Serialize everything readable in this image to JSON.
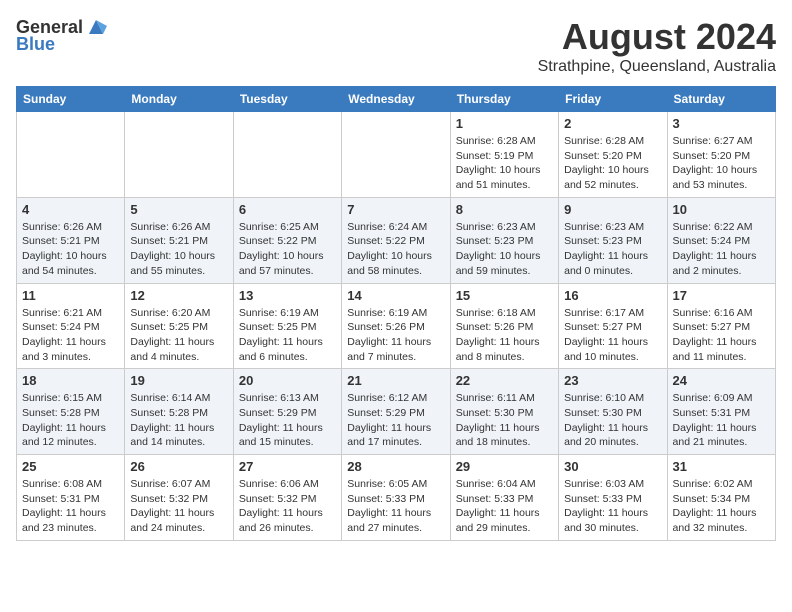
{
  "header": {
    "logo_general": "General",
    "logo_blue": "Blue",
    "month_year": "August 2024",
    "location": "Strathpine, Queensland, Australia"
  },
  "weekdays": [
    "Sunday",
    "Monday",
    "Tuesday",
    "Wednesday",
    "Thursday",
    "Friday",
    "Saturday"
  ],
  "weeks": [
    [
      {
        "day": "",
        "info": ""
      },
      {
        "day": "",
        "info": ""
      },
      {
        "day": "",
        "info": ""
      },
      {
        "day": "",
        "info": ""
      },
      {
        "day": "1",
        "info": "Sunrise: 6:28 AM\nSunset: 5:19 PM\nDaylight: 10 hours\nand 51 minutes."
      },
      {
        "day": "2",
        "info": "Sunrise: 6:28 AM\nSunset: 5:20 PM\nDaylight: 10 hours\nand 52 minutes."
      },
      {
        "day": "3",
        "info": "Sunrise: 6:27 AM\nSunset: 5:20 PM\nDaylight: 10 hours\nand 53 minutes."
      }
    ],
    [
      {
        "day": "4",
        "info": "Sunrise: 6:26 AM\nSunset: 5:21 PM\nDaylight: 10 hours\nand 54 minutes."
      },
      {
        "day": "5",
        "info": "Sunrise: 6:26 AM\nSunset: 5:21 PM\nDaylight: 10 hours\nand 55 minutes."
      },
      {
        "day": "6",
        "info": "Sunrise: 6:25 AM\nSunset: 5:22 PM\nDaylight: 10 hours\nand 57 minutes."
      },
      {
        "day": "7",
        "info": "Sunrise: 6:24 AM\nSunset: 5:22 PM\nDaylight: 10 hours\nand 58 minutes."
      },
      {
        "day": "8",
        "info": "Sunrise: 6:23 AM\nSunset: 5:23 PM\nDaylight: 10 hours\nand 59 minutes."
      },
      {
        "day": "9",
        "info": "Sunrise: 6:23 AM\nSunset: 5:23 PM\nDaylight: 11 hours\nand 0 minutes."
      },
      {
        "day": "10",
        "info": "Sunrise: 6:22 AM\nSunset: 5:24 PM\nDaylight: 11 hours\nand 2 minutes."
      }
    ],
    [
      {
        "day": "11",
        "info": "Sunrise: 6:21 AM\nSunset: 5:24 PM\nDaylight: 11 hours\nand 3 minutes."
      },
      {
        "day": "12",
        "info": "Sunrise: 6:20 AM\nSunset: 5:25 PM\nDaylight: 11 hours\nand 4 minutes."
      },
      {
        "day": "13",
        "info": "Sunrise: 6:19 AM\nSunset: 5:25 PM\nDaylight: 11 hours\nand 6 minutes."
      },
      {
        "day": "14",
        "info": "Sunrise: 6:19 AM\nSunset: 5:26 PM\nDaylight: 11 hours\nand 7 minutes."
      },
      {
        "day": "15",
        "info": "Sunrise: 6:18 AM\nSunset: 5:26 PM\nDaylight: 11 hours\nand 8 minutes."
      },
      {
        "day": "16",
        "info": "Sunrise: 6:17 AM\nSunset: 5:27 PM\nDaylight: 11 hours\nand 10 minutes."
      },
      {
        "day": "17",
        "info": "Sunrise: 6:16 AM\nSunset: 5:27 PM\nDaylight: 11 hours\nand 11 minutes."
      }
    ],
    [
      {
        "day": "18",
        "info": "Sunrise: 6:15 AM\nSunset: 5:28 PM\nDaylight: 11 hours\nand 12 minutes."
      },
      {
        "day": "19",
        "info": "Sunrise: 6:14 AM\nSunset: 5:28 PM\nDaylight: 11 hours\nand 14 minutes."
      },
      {
        "day": "20",
        "info": "Sunrise: 6:13 AM\nSunset: 5:29 PM\nDaylight: 11 hours\nand 15 minutes."
      },
      {
        "day": "21",
        "info": "Sunrise: 6:12 AM\nSunset: 5:29 PM\nDaylight: 11 hours\nand 17 minutes."
      },
      {
        "day": "22",
        "info": "Sunrise: 6:11 AM\nSunset: 5:30 PM\nDaylight: 11 hours\nand 18 minutes."
      },
      {
        "day": "23",
        "info": "Sunrise: 6:10 AM\nSunset: 5:30 PM\nDaylight: 11 hours\nand 20 minutes."
      },
      {
        "day": "24",
        "info": "Sunrise: 6:09 AM\nSunset: 5:31 PM\nDaylight: 11 hours\nand 21 minutes."
      }
    ],
    [
      {
        "day": "25",
        "info": "Sunrise: 6:08 AM\nSunset: 5:31 PM\nDaylight: 11 hours\nand 23 minutes."
      },
      {
        "day": "26",
        "info": "Sunrise: 6:07 AM\nSunset: 5:32 PM\nDaylight: 11 hours\nand 24 minutes."
      },
      {
        "day": "27",
        "info": "Sunrise: 6:06 AM\nSunset: 5:32 PM\nDaylight: 11 hours\nand 26 minutes."
      },
      {
        "day": "28",
        "info": "Sunrise: 6:05 AM\nSunset: 5:33 PM\nDaylight: 11 hours\nand 27 minutes."
      },
      {
        "day": "29",
        "info": "Sunrise: 6:04 AM\nSunset: 5:33 PM\nDaylight: 11 hours\nand 29 minutes."
      },
      {
        "day": "30",
        "info": "Sunrise: 6:03 AM\nSunset: 5:33 PM\nDaylight: 11 hours\nand 30 minutes."
      },
      {
        "day": "31",
        "info": "Sunrise: 6:02 AM\nSunset: 5:34 PM\nDaylight: 11 hours\nand 32 minutes."
      }
    ]
  ]
}
